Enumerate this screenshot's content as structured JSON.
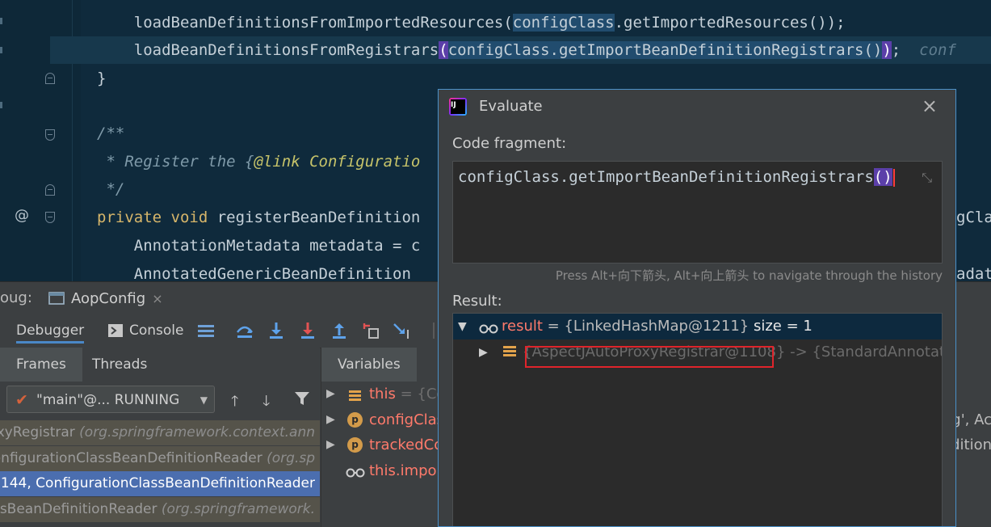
{
  "editor": {
    "lines": [
      {
        "pre": "    loadBeanDefinitionsFromImportedResources(",
        "sel": "configClass",
        "post": ".getImportedResources());"
      },
      {
        "pre": "    loadBeanDefinitionsFromRegistrars",
        "paren_open": "(",
        "sel": "configClass.getImportBeanDefinitionRegistrars()",
        "paren_close": ")",
        "post": ";",
        "hint": "conf"
      },
      {
        "text": "}"
      },
      {
        "text": "/**"
      },
      {
        "cmt_pre": " * Register the {",
        "cmt_link": "@link Configuratio"
      },
      {
        "text": " */"
      },
      {
        "kw": "private void ",
        "rest": "registerBeanDefinition",
        "tail": "gCla"
      },
      {
        "text": "    AnnotationMetadata metadata = c"
      },
      {
        "text": "    AnnotatedGenericBeanDefinition",
        "tail": "adat"
      }
    ],
    "gutter_symbol": "@"
  },
  "debug": {
    "title_prefix": "oug:",
    "run_config": "AopConfig",
    "tab_close": "×",
    "tabs": {
      "debugger": "Debugger",
      "console": "Console"
    },
    "frames_tab": "Frames",
    "threads_tab": "Threads",
    "thread_selector": "\"main\"@... RUNNING",
    "frames": [
      {
        "text": "oxyRegistrar ",
        "pkg": "(org.springframework.context.ann"
      },
      {
        "text": "onfigurationClassBeanDefinitionReader ",
        "pkg": "(org.sp"
      },
      {
        "text": "144, ConfigurationClassBeanDefinitionReader",
        "pkg": ""
      },
      {
        "text": "ssBeanDefinitionReader ",
        "pkg": "(org.springframework."
      }
    ],
    "variables_tab": "Variables",
    "variables": [
      {
        "name": "this",
        "value": " = {Co",
        "tail": ""
      },
      {
        "name": "configClas",
        "value": "",
        "tail": "g', Ac"
      },
      {
        "name": "trackedCo",
        "value": "",
        "tail": "dition"
      },
      {
        "name": "this.impor",
        "value": "",
        "tail": ""
      }
    ]
  },
  "evaluate": {
    "title": "Evaluate",
    "close": "×",
    "code_fragment_label": "Code fragment:",
    "code": "configClass.getImportBeanDefinitionRegistrars",
    "code_parens": "()",
    "hint": "Press Alt+向下箭头, Alt+向上箭头 to navigate through the history",
    "result_label": "Result:",
    "result_row": {
      "name": "result",
      "value": " = {LinkedHashMap@1211} ",
      "size": " size = 1"
    },
    "entry_row": {
      "key": "{AspectJAutoProxyRegistrar@1108}",
      "value": "  -> {StandardAnnotation"
    }
  }
}
